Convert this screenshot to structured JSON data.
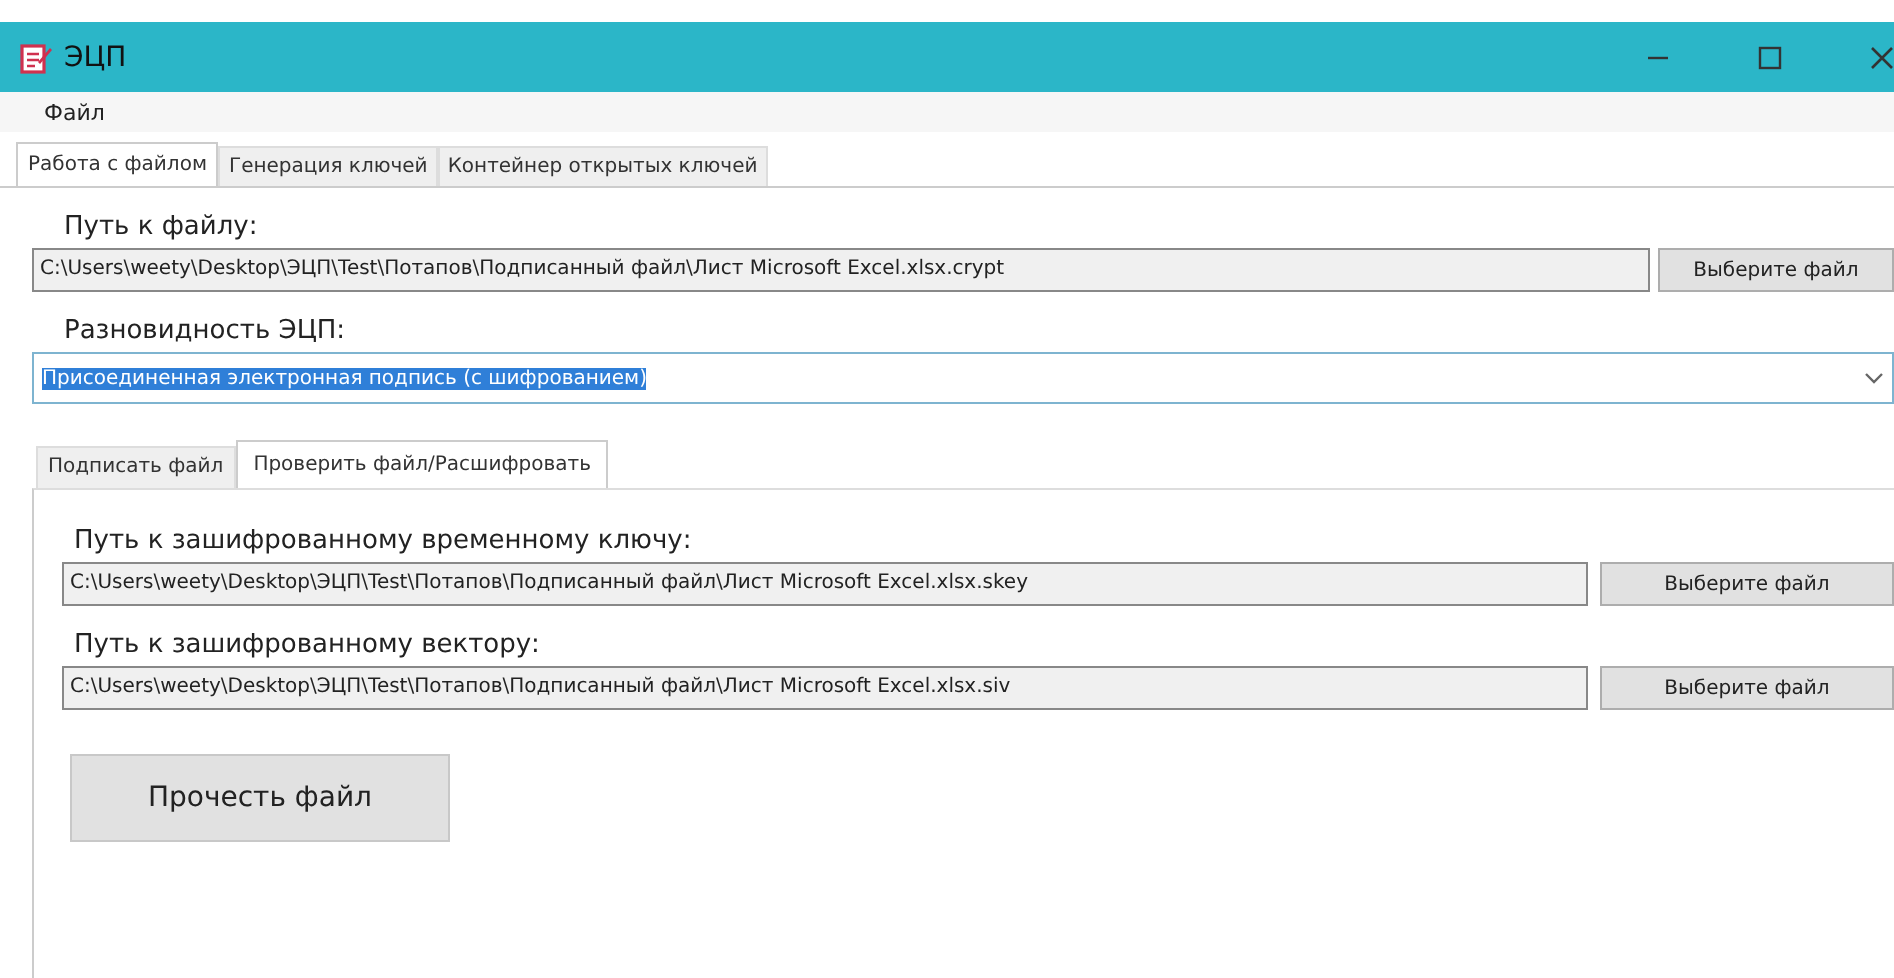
{
  "window": {
    "title": "ЭЦП"
  },
  "menu": [
    {
      "label": "Файл"
    }
  ],
  "tabs": [
    {
      "label": "Работа с файлом",
      "selected": true
    },
    {
      "label": "Генерация ключей",
      "selected": false
    },
    {
      "label": "Контейнер открытых ключей",
      "selected": false
    }
  ],
  "file_path": {
    "label": "Путь к файлу:",
    "value": "C:\\Users\\weety\\Desktop\\ЭЦП\\Test\\Потапов\\Подписанный файл\\Лист Microsoft Excel.xlsx.crypt",
    "button": "Выберите файл"
  },
  "signature_type": {
    "label": "Разновидность ЭЦП:",
    "value": "Присоединенная электронная подпись (с шифрованием)",
    "text_selected": true
  },
  "inner_tabs": [
    {
      "label": "Подписать файл",
      "selected": false
    },
    {
      "label": "Проверить файл/Расшифровать",
      "selected": true
    }
  ],
  "fields": [
    {
      "label": "Путь к зашифрованному временному ключу:",
      "value": "C:\\Users\\weety\\Desktop\\ЭЦП\\Test\\Потапов\\Подписанный файл\\Лист Microsoft Excel.xlsx.skey",
      "button": "Выберите файл"
    },
    {
      "label": "Путь к зашифрованному вектору:",
      "value": "C:\\Users\\weety\\Desktop\\ЭЦП\\Test\\Потапов\\Подписанный файл\\Лист Microsoft Excel.xlsx.siv",
      "button": "Выберите файл"
    }
  ],
  "action_button": "Прочесть файл"
}
